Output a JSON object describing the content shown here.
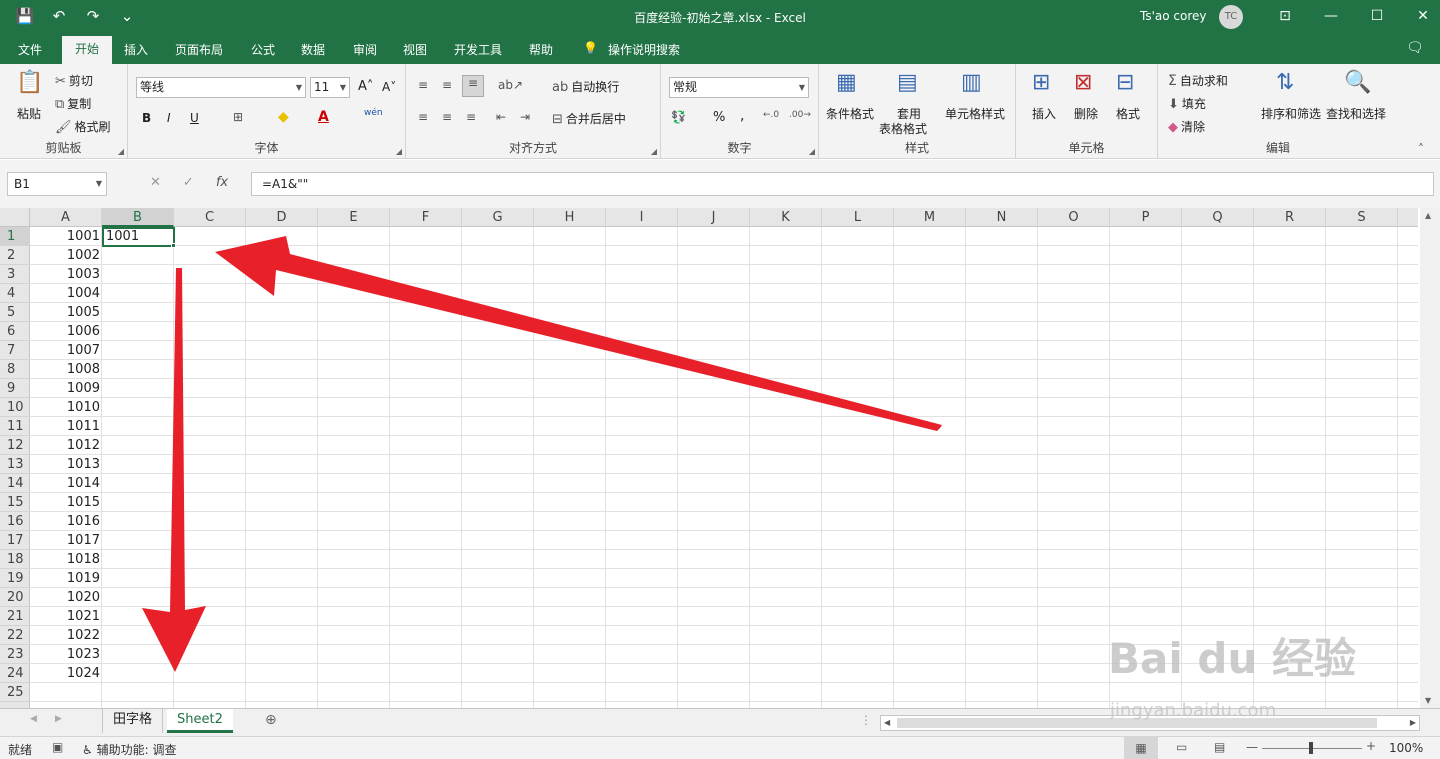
{
  "titlebar": {
    "file_title": "百度经验-初始之章.xlsx  -  Excel",
    "user": "Ts'ao corey",
    "avatar": "TC"
  },
  "tabs": [
    "文件",
    "开始",
    "插入",
    "页面布局",
    "公式",
    "数据",
    "审阅",
    "视图",
    "开发工具",
    "帮助",
    "操作说明搜索"
  ],
  "ribbon": {
    "clipboard": {
      "paste": "粘贴",
      "cut": "剪切",
      "copy": "复制",
      "format_painter": "格式刷",
      "label": "剪贴板"
    },
    "font": {
      "name": "等线",
      "size": "11",
      "bold": "B",
      "italic": "I",
      "underline": "U",
      "label": "字体",
      "wen": "wén"
    },
    "align": {
      "wrap": "自动换行",
      "merge": "合并后居中",
      "label": "对齐方式"
    },
    "number": {
      "format": "常规",
      "percent": "%",
      "comma": ",",
      "label": "数字"
    },
    "styles": {
      "conditional": "条件格式",
      "table1": "套用",
      "table2": "表格格式",
      "cell_styles": "单元格样式",
      "label": "样式"
    },
    "cells": {
      "insert": "插入",
      "delete": "删除",
      "format": "格式",
      "label": "单元格"
    },
    "editing": {
      "autosum": "自动求和",
      "fill": "填充",
      "clear": "清除",
      "sort": "排序和筛选",
      "find": "查找和选择",
      "label": "编辑"
    }
  },
  "formula_bar": {
    "name_box": "B1",
    "formula": "=A1&\"\"",
    "fx": "fx"
  },
  "columns": [
    "A",
    "B",
    "C",
    "D",
    "E",
    "F",
    "G",
    "H",
    "I",
    "J",
    "K",
    "L",
    "M",
    "N",
    "O",
    "P",
    "Q",
    "R",
    "S"
  ],
  "rows": [
    "1",
    "2",
    "3",
    "4",
    "5",
    "6",
    "7",
    "8",
    "9",
    "10",
    "11",
    "12",
    "13",
    "14",
    "15",
    "16",
    "17",
    "18",
    "19",
    "20",
    "21",
    "22",
    "23",
    "24",
    "25"
  ],
  "col_a_values": [
    "1001",
    "1002",
    "1003",
    "1004",
    "1005",
    "1006",
    "1007",
    "1008",
    "1009",
    "1010",
    "1011",
    "1012",
    "1013",
    "1014",
    "1015",
    "1016",
    "1017",
    "1018",
    "1019",
    "1020",
    "1021",
    "1022",
    "1023",
    "1024"
  ],
  "b1_value": "1001",
  "sheets": {
    "tab1": "田字格",
    "tab2": "Sheet2"
  },
  "status": {
    "ready": "就绪",
    "accessibility": "辅助功能: 调查",
    "zoom": "100%"
  },
  "watermark": {
    "brand": "Bai du 经验",
    "url": "jingyan.baidu.com"
  },
  "colors": {
    "excel_green": "#217346",
    "arrow_red": "#e8202a"
  }
}
